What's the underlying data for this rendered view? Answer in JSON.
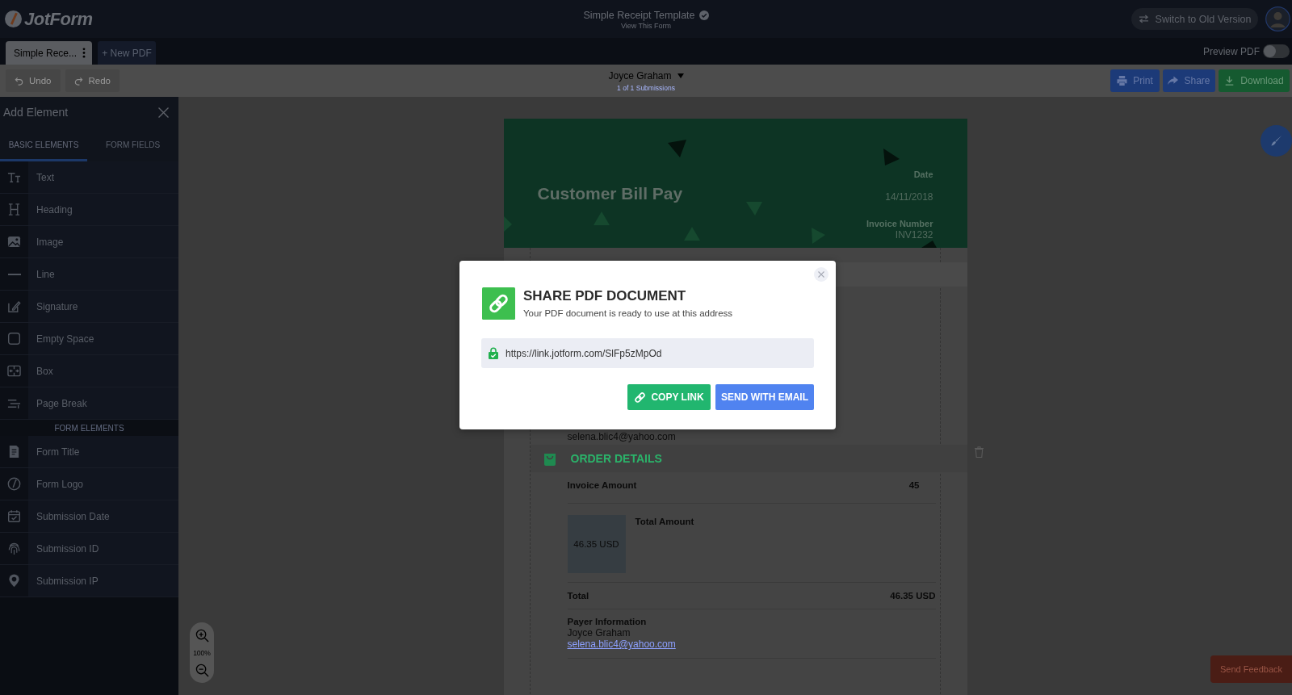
{
  "header": {
    "logo": "JotForm",
    "title": "Simple Receipt Template",
    "subtitle": "View This Form",
    "switch_button": "Switch to Old Version"
  },
  "pdf_tabs": [
    {
      "label": "Simple Rece...",
      "selected": true
    }
  ],
  "new_pdf_button": "+ New PDF",
  "preview_pdf": {
    "label": "Preview PDF",
    "on": false
  },
  "toolbar": {
    "undo": "Undo",
    "redo": "Redo",
    "submission_name": "Joyce Graham",
    "submission_count": "1 of 1 Submissions",
    "actions": [
      {
        "label": "Print",
        "kind": "print"
      },
      {
        "label": "Share",
        "kind": "share"
      },
      {
        "label": "Download",
        "kind": "download"
      }
    ]
  },
  "sidebar": {
    "title": "Add Element",
    "tabs": [
      {
        "label": "BASIC ELEMENTS",
        "selected": true
      },
      {
        "label": "FORM FIELDS",
        "selected": false
      }
    ],
    "groups": [
      {
        "items": [
          {
            "label": "Text",
            "kind": "text"
          },
          {
            "label": "Heading",
            "kind": "heading"
          },
          {
            "label": "Image",
            "kind": "image"
          },
          {
            "label": "Line",
            "kind": "line"
          },
          {
            "label": "Signature",
            "kind": "signature"
          },
          {
            "label": "Empty Space",
            "kind": "empty_space"
          },
          {
            "label": "Box",
            "kind": "box"
          },
          {
            "label": "Page Break",
            "kind": "page_break"
          }
        ]
      },
      {
        "heading": "FORM ELEMENTS",
        "items": [
          {
            "label": "Form Title",
            "kind": "form_title"
          },
          {
            "label": "Form Logo",
            "kind": "form_logo"
          },
          {
            "label": "Submission Date",
            "kind": "submission_date"
          },
          {
            "label": "Submission ID",
            "kind": "submission_id"
          },
          {
            "label": "Submission IP",
            "kind": "submission_ip"
          }
        ]
      }
    ]
  },
  "canvas": {
    "zoom_level": "100%"
  },
  "document": {
    "title": "Customer Bill Pay",
    "date_label": "Date",
    "date": "14/11/2018",
    "invoice_label": "Invoice Number",
    "invoice_number": "INV1232",
    "payer_email_partial": "selena.blic4@yahoo.com",
    "section": "ORDER DETAILS",
    "invoice_amount": {
      "label": "Invoice Amount",
      "value": "45"
    },
    "total_amount": {
      "label": "Total Amount",
      "value": "46.35 USD"
    },
    "total": {
      "label": "Total",
      "value": "46.35 USD"
    },
    "payer": {
      "label": "Payer Information",
      "name": "Joyce Graham",
      "email": "selena.blic4@yahoo.com"
    }
  },
  "modal": {
    "title": "SHARE PDF DOCUMENT",
    "subtitle": "Your PDF document is ready to use at this address",
    "url": "https://link.jotform.com/SlFp5zMpOd",
    "buttons": [
      {
        "label": "COPY LINK",
        "kind": "copy"
      },
      {
        "label": "SEND WITH EMAIL",
        "kind": "email"
      }
    ]
  },
  "feedback_button": "Send Feedback"
}
